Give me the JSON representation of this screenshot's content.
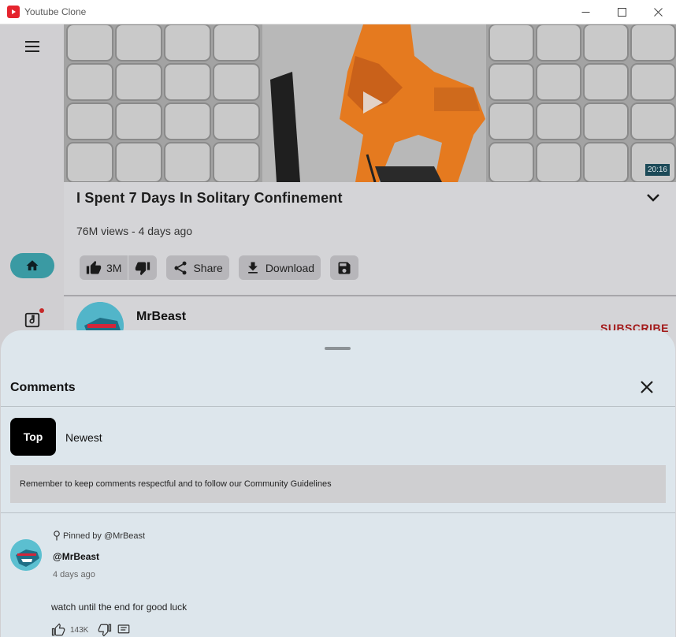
{
  "window": {
    "title": "Youtube Clone"
  },
  "video": {
    "duration": "20:16",
    "title": "I Spent 7 Days In Solitary Confinement",
    "meta": "76M views - 4 days ago",
    "likes": "3M",
    "share_label": "Share",
    "download_label": "Download"
  },
  "channel": {
    "name": "MrBeast",
    "subscribe_label": "SUBSCRIBE"
  },
  "comments": {
    "title": "Comments",
    "tabs": {
      "top": "Top",
      "newest": "Newest"
    },
    "notice": "Remember to keep comments respectful and to follow our Community Guidelines",
    "items": [
      {
        "pinned": "Pinned by @MrBeast",
        "author": "@MrBeast",
        "time": "4 days ago",
        "text": "watch until the end for good luck",
        "likes": "143K"
      }
    ]
  },
  "icons": [
    "hamburger-menu-icon",
    "home-icon",
    "music-library-icon",
    "play-icon",
    "chevron-down-icon",
    "thumb-up-icon",
    "thumb-down-icon",
    "share-icon",
    "download-icon",
    "save-icon",
    "close-icon",
    "pin-icon",
    "reply-icon"
  ],
  "colors": {
    "accent": "#3a9aa3",
    "subscribe": "#a31a1a",
    "sheet_bg": "#dde6ec",
    "notification_dot": "#c62828"
  }
}
